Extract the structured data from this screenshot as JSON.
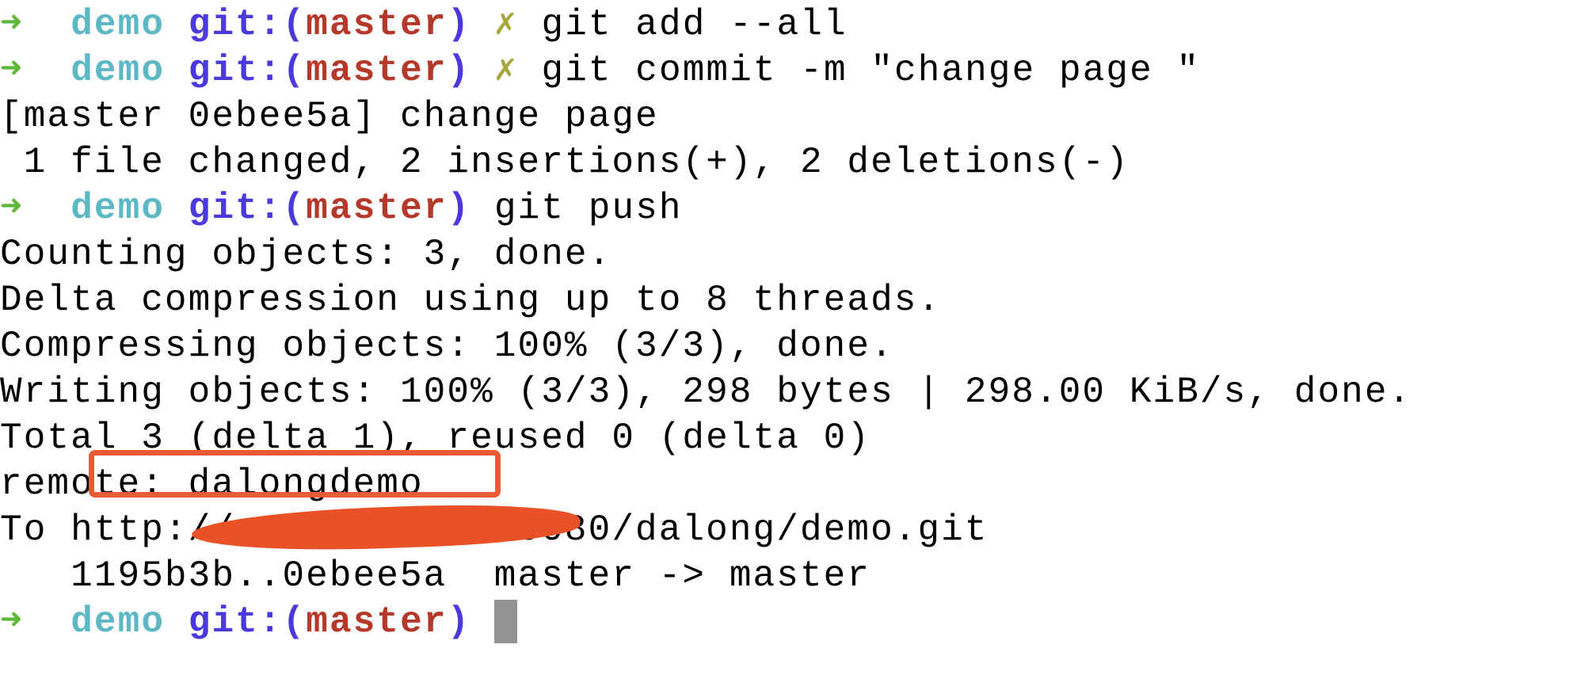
{
  "prompt": {
    "arrow": "➜",
    "dir": "demo",
    "git_open": "git:(",
    "branch": "master",
    "git_close": ")",
    "dirty": "✗"
  },
  "lines": [
    {
      "type": "prompt",
      "dirty": true,
      "cmd": "git add --all"
    },
    {
      "type": "prompt",
      "dirty": true,
      "cmd": "git commit -m \"change page \""
    },
    {
      "type": "out",
      "text": "[master 0ebee5a] change page"
    },
    {
      "type": "out",
      "text": " 1 file changed, 2 insertions(+), 2 deletions(-)"
    },
    {
      "type": "prompt",
      "dirty": false,
      "cmd": "git push"
    },
    {
      "type": "out",
      "text": "Counting objects: 3, done."
    },
    {
      "type": "out",
      "text": "Delta compression using up to 8 threads."
    },
    {
      "type": "out",
      "text": "Compressing objects: 100% (3/3), done."
    },
    {
      "type": "out",
      "text": "Writing objects: 100% (3/3), 298 bytes | 298.00 KiB/s, done."
    },
    {
      "type": "out",
      "text": "Total 3 (delta 1), reused 0 (delta 0)"
    },
    {
      "type": "out",
      "text": "remote: dalongdemo"
    },
    {
      "type": "out",
      "text": "To http://          :10080/dalong/demo.git"
    },
    {
      "type": "out",
      "text": "   1195b3b..0ebee5a  master -> master"
    },
    {
      "type": "prompt",
      "dirty": false,
      "cmd": "",
      "cursor": true
    }
  ],
  "colors": {
    "arrow": "#5fb83a",
    "dir": "#5bb8c4",
    "git": "#4b3adb",
    "branch": "#b5392a",
    "dirty": "#a8a83a",
    "annotation": "#ea5a35"
  }
}
